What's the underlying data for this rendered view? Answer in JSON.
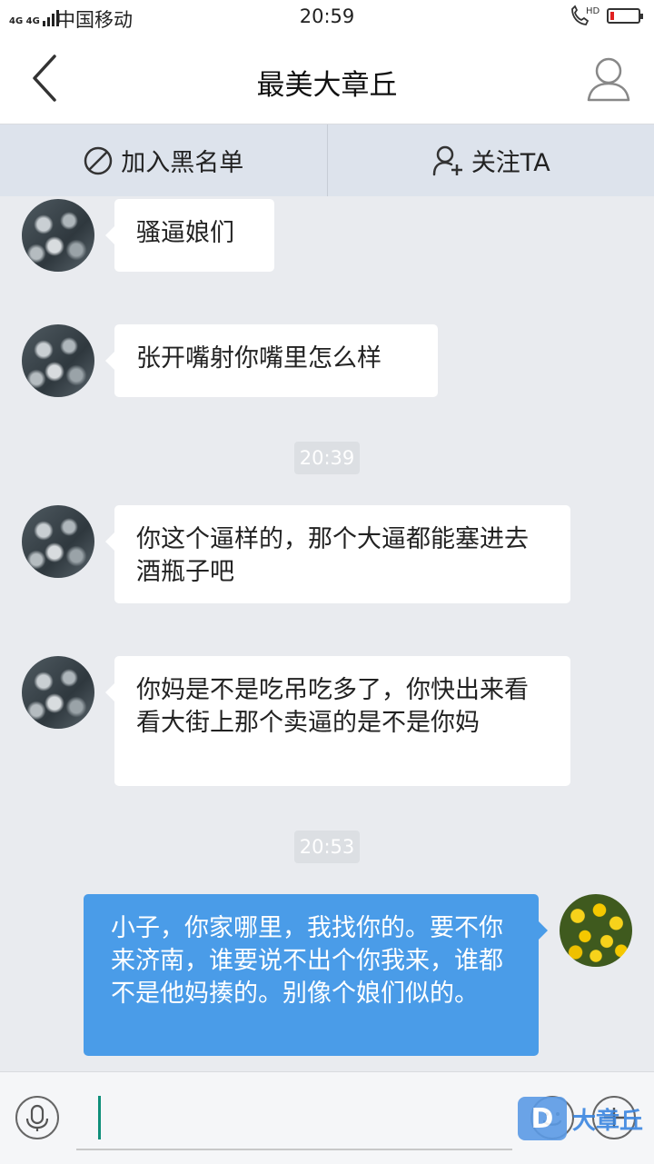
{
  "status_bar": {
    "network": "4G 4G",
    "carrier": "中国移动",
    "time": "20:59",
    "call_badge": "HD",
    "battery_level": 0.15
  },
  "header": {
    "title": "最美大章丘",
    "back_icon": "chevron-left-icon",
    "profile_icon": "user-icon"
  },
  "actions": {
    "block_label": "加入黑名单",
    "block_icon": "block-icon",
    "follow_label": "关注TA",
    "follow_icon": "add-user-icon"
  },
  "messages": [
    {
      "type": "incoming",
      "text": "骚逼娘们"
    },
    {
      "type": "incoming",
      "text": "张开嘴射你嘴里怎么样"
    },
    {
      "type": "time",
      "text": "20:39"
    },
    {
      "type": "incoming",
      "text": "你这个逼样的，那个大逼都能塞进去酒瓶子吧"
    },
    {
      "type": "incoming",
      "text": "你妈是不是吃吊吃多了，你快出来看看大街上那个卖逼的是不是你妈"
    },
    {
      "type": "time",
      "text": "20:53"
    },
    {
      "type": "outgoing",
      "text": "小子，你家哪里，我找你的。要不你来济南，谁要说不出个你我来，谁都不是他妈揍的。别像个娘们似的。"
    }
  ],
  "input_bar": {
    "voice_icon": "microphone-icon",
    "input_value": "",
    "emoji_icon": "emoji-icon",
    "plus_icon": "plus-icon"
  },
  "watermark": {
    "badge": "D",
    "text": "大章丘"
  },
  "colors": {
    "accent": "#4a9ce8",
    "background": "#e9ebef",
    "action_bar": "#dde3ec",
    "battery_low": "#e02020"
  }
}
